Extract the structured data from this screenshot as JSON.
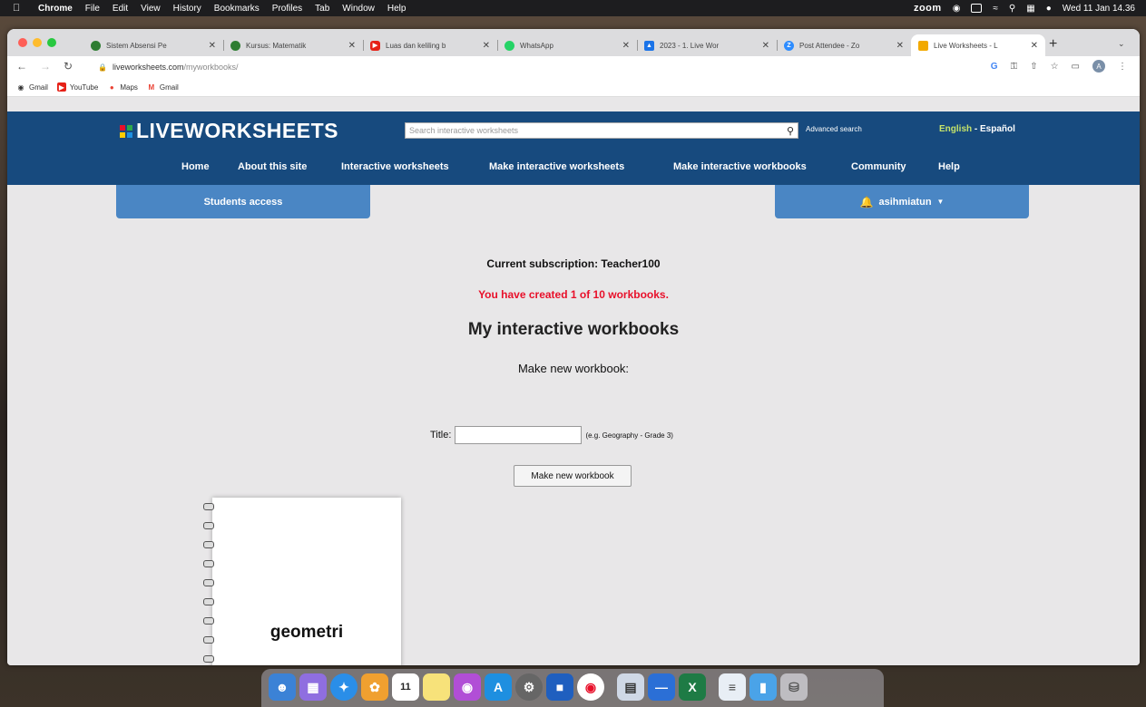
{
  "menubar": {
    "app": "Chrome",
    "items": [
      "File",
      "Edit",
      "View",
      "History",
      "Bookmarks",
      "Profiles",
      "Tab",
      "Window",
      "Help"
    ],
    "zoom": "zoom",
    "clock": "Wed 11 Jan 14.36"
  },
  "tabs": [
    {
      "title": "Sistem Absensi Pe",
      "color": "#2e7d32"
    },
    {
      "title": "Kursus: Matematik",
      "color": "#2e7d32"
    },
    {
      "title": "Luas dan keliling b",
      "color": "#e62117"
    },
    {
      "title": "WhatsApp",
      "color": "#25d366"
    },
    {
      "title": "2023 - 1. Live Wor",
      "color": "#1a73e8"
    },
    {
      "title": "Post Attendee - Zo",
      "color": "#2d8cff"
    },
    {
      "title": "Live Worksheets - L",
      "color": "#f2a900"
    }
  ],
  "address": {
    "host": "liveworksheets.com",
    "path": "/myworkbooks/",
    "profile": "A"
  },
  "bookmarks": [
    "Gmail",
    "YouTube",
    "Maps",
    "Gmail"
  ],
  "site": {
    "logo": "LIVEWORKSHEETS",
    "logo_colors": [
      "#e8102a",
      "#2ea84a",
      "#ffcc00",
      "#1e8fe0"
    ],
    "search_placeholder": "Search interactive worksheets",
    "advanced_search": "Advanced search",
    "lang_en": "English",
    "lang_es": " - Español",
    "nav": [
      "Home",
      "About this site",
      "Interactive worksheets",
      "Make interactive worksheets",
      "Make interactive workbooks",
      "Community",
      "Help"
    ],
    "students_access": "Students access",
    "username": "asihmiatun"
  },
  "main": {
    "subscription": "Current subscription: Teacher100",
    "created": "You have created 1 of 10 workbooks.",
    "heading": "My interactive workbooks",
    "make_new": "Make new workbook:",
    "title_label": "Title:",
    "title_value": "",
    "title_hint": "(e.g. Geography - Grade 3)",
    "button": "Make new workbook"
  },
  "workbooks": [
    {
      "title": "geometri"
    }
  ],
  "dock": {
    "calendar_day": "11"
  }
}
